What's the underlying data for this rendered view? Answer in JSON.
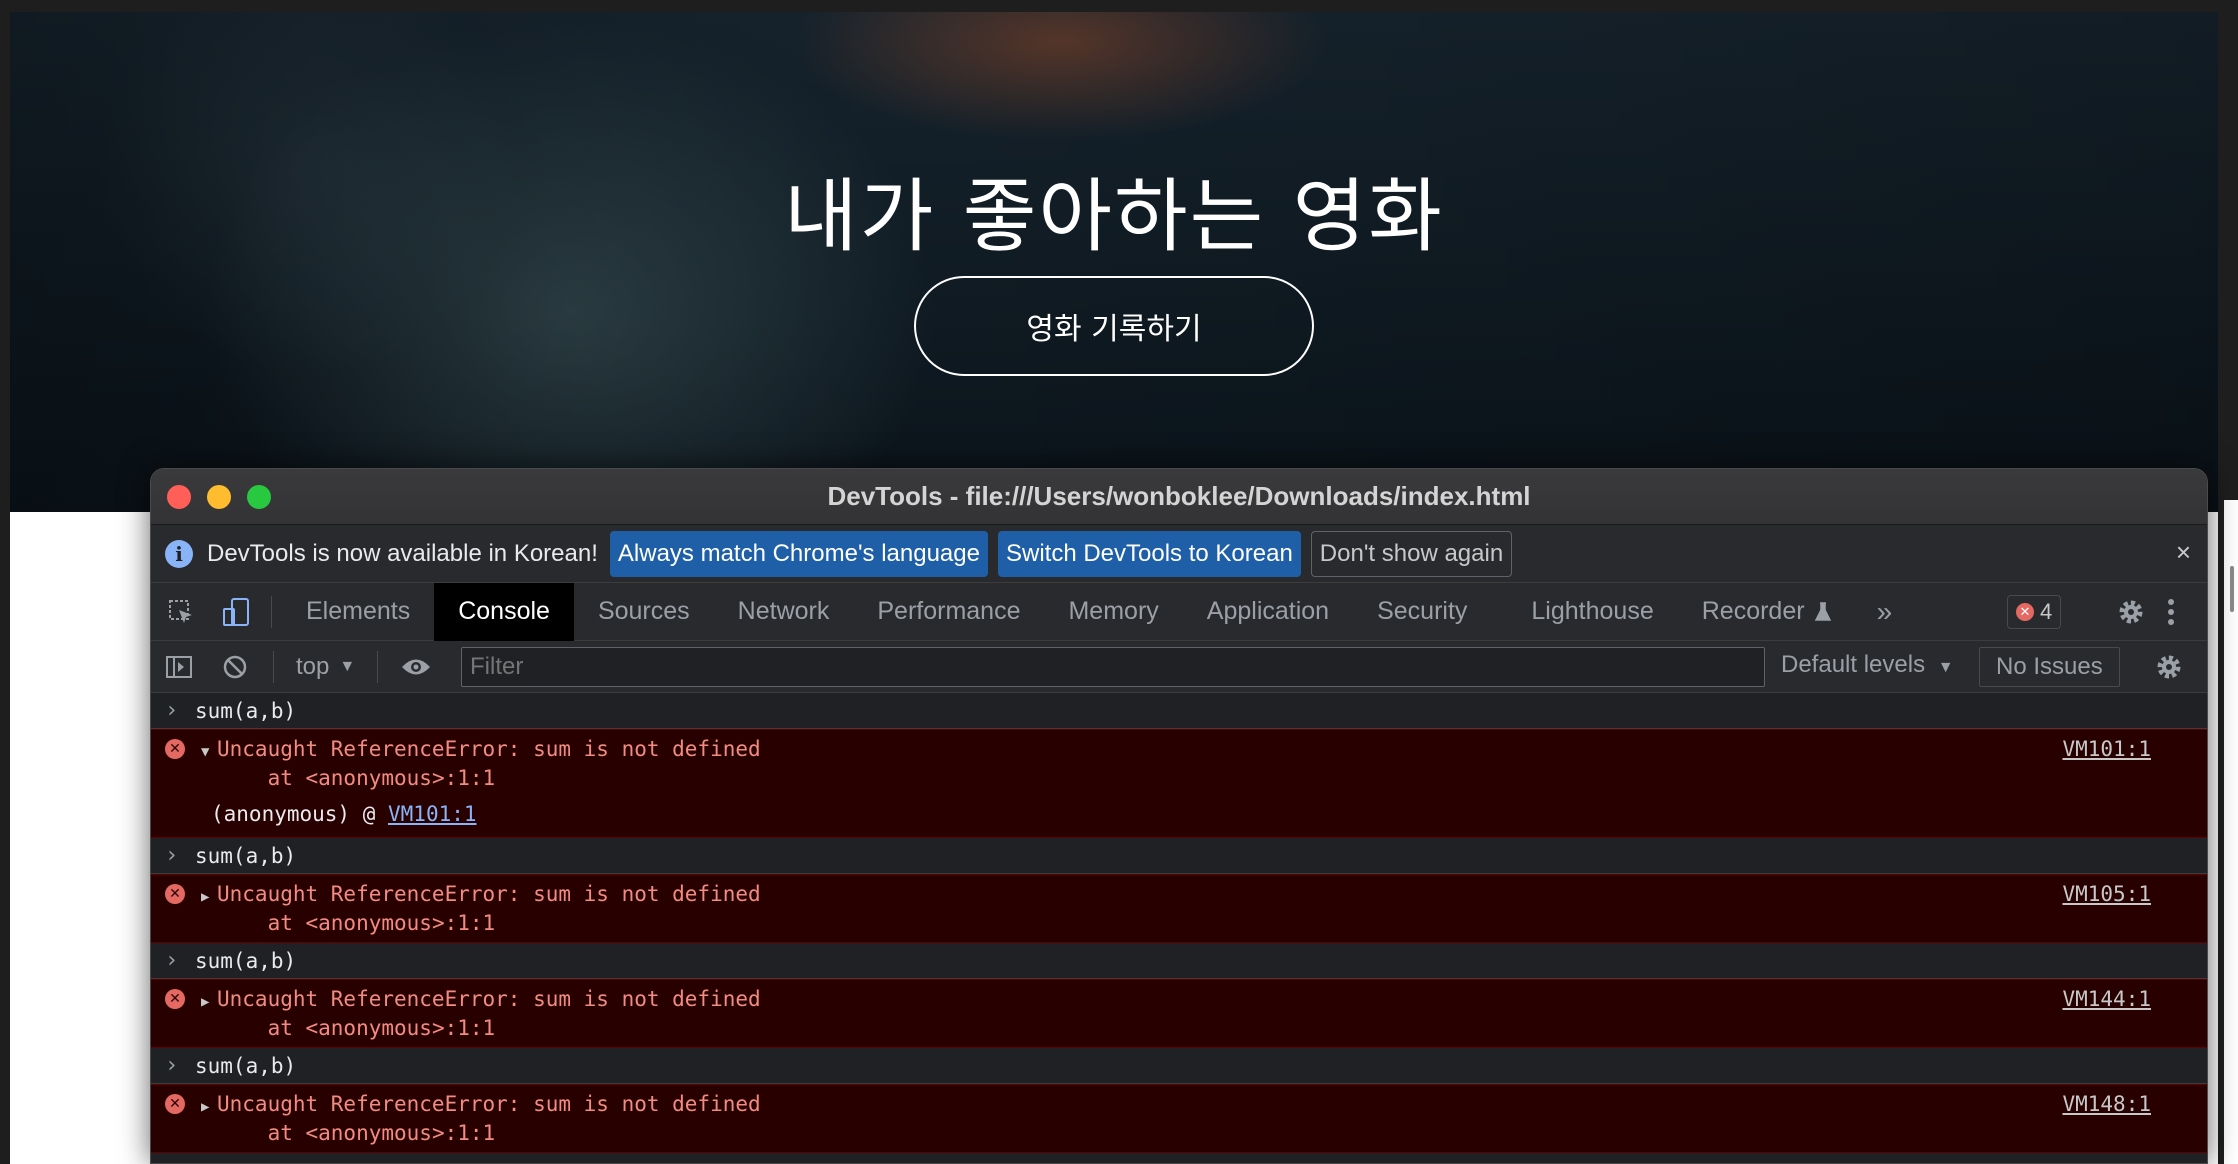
{
  "page": {
    "hero_title": "내가 좋아하는 영화",
    "hero_button": "영화 기록하기"
  },
  "devtools": {
    "window_title": "DevTools - file:///Users/wonboklee/Downloads/index.html",
    "infobar": {
      "message": "DevTools is now available in Korean!",
      "btn_match": "Always match Chrome's language",
      "btn_switch": "Switch DevTools to Korean",
      "btn_dismiss": "Don't show again",
      "close": "×"
    },
    "tabs": [
      "Elements",
      "Console",
      "Sources",
      "Network",
      "Performance",
      "Memory",
      "Application",
      "Security",
      "Lighthouse",
      "Recorder"
    ],
    "active_tab": "Console",
    "more_tabs": "»",
    "error_count": "4",
    "filterbar": {
      "context": "top",
      "filter_placeholder": "Filter",
      "levels": "Default levels",
      "issues": "No Issues"
    },
    "console": {
      "entries": [
        {
          "input": "sum(a,b)",
          "error": "Uncaught ReferenceError: sum is not defined",
          "location": "at <anonymous>:1:1",
          "source": "VM101:1",
          "expanded": true,
          "stack_fn": "(anonymous) @ ",
          "stack_link": "VM101:1"
        },
        {
          "input": "sum(a,b)",
          "error": "Uncaught ReferenceError: sum is not defined",
          "location": "at <anonymous>:1:1",
          "source": "VM105:1"
        },
        {
          "input": "sum(a,b)",
          "error": "Uncaught ReferenceError: sum is not defined",
          "location": "at <anonymous>:1:1",
          "source": "VM144:1"
        },
        {
          "input": "sum(a,b)",
          "error": "Uncaught ReferenceError: sum is not defined",
          "location": "at <anonymous>:1:1",
          "source": "VM148:1"
        }
      ]
    }
  },
  "colors": {
    "error_bg": "#290000",
    "error_text": "#f28b82",
    "accent_blue": "#1f5fa7"
  },
  "icons": {
    "inspect": "inspect-element-icon",
    "device": "device-toolbar-icon",
    "sidebar": "console-sidebar-icon",
    "clear": "clear-console-icon",
    "eye": "live-expression-eye-icon",
    "gear": "gear-icon",
    "kebab": "more-options-icon",
    "flask": "experimental-flask-icon"
  }
}
